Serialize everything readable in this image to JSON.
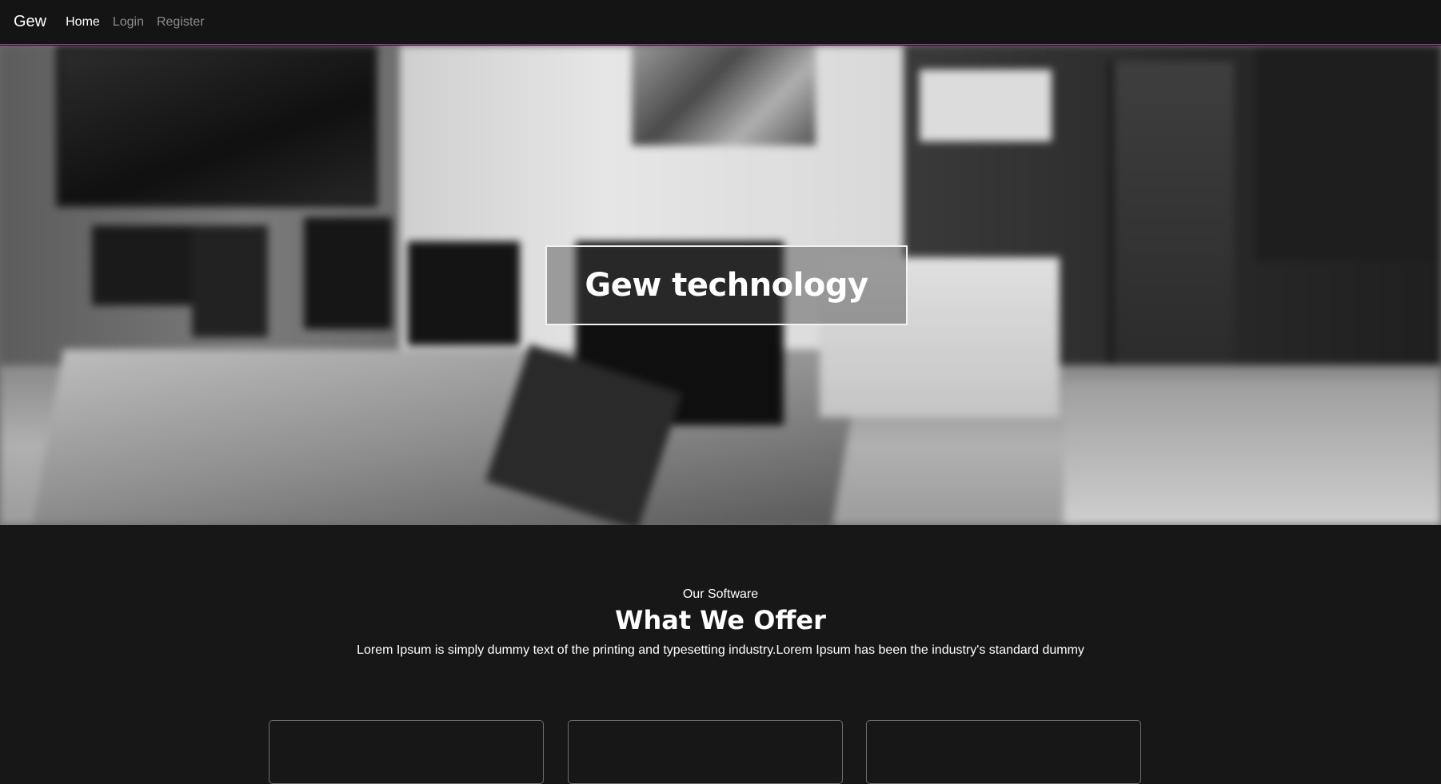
{
  "navbar": {
    "brand": "Gew",
    "links": [
      {
        "label": "Home",
        "active": true
      },
      {
        "label": "Login",
        "active": false
      },
      {
        "label": "Register",
        "active": false
      }
    ],
    "accent_border_color": "#a33aa6"
  },
  "hero": {
    "title": "Gew technology",
    "background_description_icon": "office-photo-blurred"
  },
  "offer": {
    "kicker": "Our Software",
    "heading": "What We Offer",
    "description": "Lorem Ipsum is simply dummy text of the printing and typesetting industry.Lorem Ipsum has been the industry's standard dummy"
  },
  "colors": {
    "page_background": "#171717",
    "navbar_background": "#141414",
    "text": "#ffffff",
    "muted_link": "#8d8d8d"
  }
}
